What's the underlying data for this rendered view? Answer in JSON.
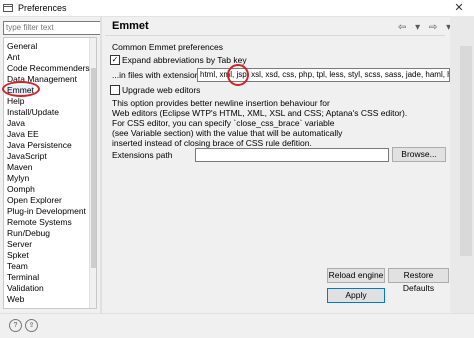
{
  "window": {
    "title": "Preferences",
    "close_glyph": "✕"
  },
  "filter": {
    "placeholder": "type filter text"
  },
  "tree": {
    "items": [
      {
        "label": "General"
      },
      {
        "label": "Ant"
      },
      {
        "label": "Code Recommenders"
      },
      {
        "label": "Data Management"
      },
      {
        "label": "Emmet"
      },
      {
        "label": "Help"
      },
      {
        "label": "Install/Update"
      },
      {
        "label": "Java"
      },
      {
        "label": "Java EE"
      },
      {
        "label": "Java Persistence"
      },
      {
        "label": "JavaScript"
      },
      {
        "label": "Maven"
      },
      {
        "label": "Mylyn"
      },
      {
        "label": "Oomph"
      },
      {
        "label": "Open Explorer"
      },
      {
        "label": "Plug-in Development"
      },
      {
        "label": "Remote Systems"
      },
      {
        "label": "Run/Debug"
      },
      {
        "label": "Server"
      },
      {
        "label": "Spket"
      },
      {
        "label": "Team"
      },
      {
        "label": "Terminal"
      },
      {
        "label": "Validation"
      },
      {
        "label": "Web"
      }
    ],
    "selected": "Emmet"
  },
  "page": {
    "title": "Emmet",
    "nav": {
      "back_glyph": "⇦",
      "dropdown_glyph": "▾",
      "forward_glyph": "⇨",
      "menu_glyph": "▾"
    },
    "section_title": "Common Emmet preferences",
    "expand_label": "Expand abbreviations by Tab key",
    "expand_checked": true,
    "files_label": "...in files with extensions",
    "extensions_value": "html, xml, jsp, xsl, xsd, css, php, tpl, less, styl, scss, sass, jade, haml, hbs, twig",
    "upgrade_label": "Upgrade web editors",
    "upgrade_checked": false,
    "info_lines": [
      "This option provides better newline insertion behaviour for",
      "Web editors (Eclipse WTP's HTML, XML, XSL and CSS; Aptana's CSS editor).",
      "For CSS editor, you can specify `close_css_brace` variable",
      "(see Variable section) with the value that will be automatically",
      "inserted instead of closing brace of CSS rule defition."
    ],
    "ext_path_label": "Extensions path",
    "ext_path_value": "",
    "browse_label": "Browse...",
    "reload_label": "Reload engine",
    "restore_label": "Restore Defaults",
    "apply_label": "Apply"
  },
  "bottom": {
    "help_glyph": "?",
    "import_glyph": "⇪"
  },
  "colors": {
    "annotation_red": "#d0242b",
    "selection": "#e5f1fb"
  }
}
